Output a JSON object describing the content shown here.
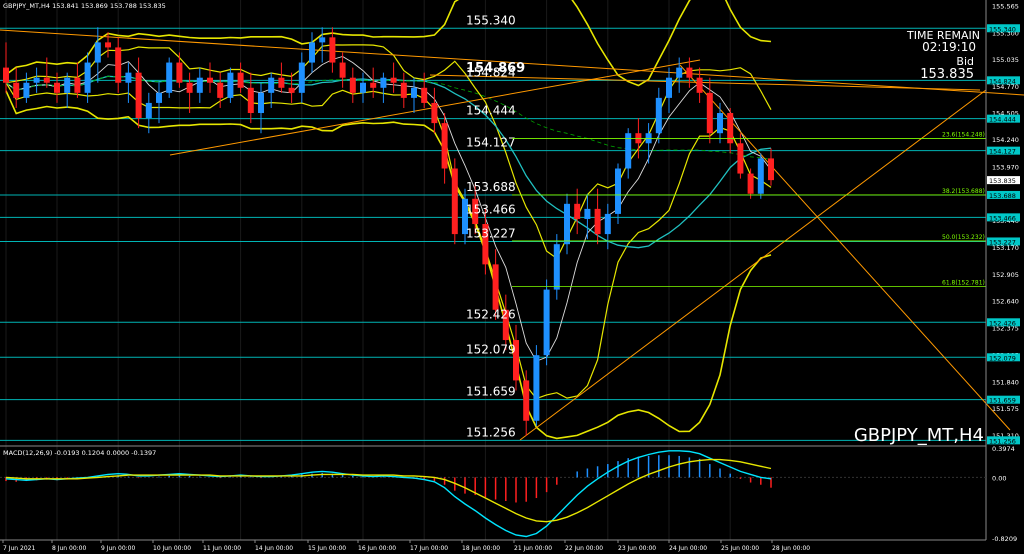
{
  "header": {
    "symbol_info": "GBPJPY_MT,H4  153.841  153.869  153.788  153.835",
    "macd_label": "MACD(12,26,9) -0.0193 0.1204 0.0000 -0.1397"
  },
  "overlay": {
    "time_remain_label": "TIME REMAIN",
    "time_remain_value": "02:19:10",
    "bid_label": "Bid",
    "bid_value": "153.835",
    "watermark": "GBPJPY_MT,H4"
  },
  "levels": [
    {
      "label": "155.340",
      "value": 155.34,
      "bold": false
    },
    {
      "label": "154.824",
      "value": 154.824,
      "bold": false
    },
    {
      "label": "154.869",
      "value": 154.869,
      "bold": true
    },
    {
      "label": "154.444",
      "value": 154.444,
      "bold": false
    },
    {
      "label": "154.127",
      "value": 154.127,
      "bold": false
    },
    {
      "label": "153.688",
      "value": 153.688,
      "bold": false
    },
    {
      "label": "153.466",
      "value": 153.466,
      "bold": false
    },
    {
      "label": "153.227",
      "value": 153.227,
      "bold": false
    },
    {
      "label": "152.426",
      "value": 152.426,
      "bold": false
    },
    {
      "label": "152.079",
      "value": 152.079,
      "bold": false
    },
    {
      "label": "151.659",
      "value": 151.659,
      "bold": false
    },
    {
      "label": "151.256",
      "value": 151.256,
      "bold": false
    }
  ],
  "fib_labels": [
    {
      "label": "23.6(154.248)",
      "value": 154.248
    },
    {
      "label": "38.2(153.688)",
      "value": 153.688
    },
    {
      "label": "50.0(153.232)",
      "value": 153.232
    },
    {
      "label": "61.8(152.781)",
      "value": 152.781
    }
  ],
  "price_axis": {
    "ticks": [
      "155.565",
      "155.300",
      "155.035",
      "154.770",
      "154.505",
      "154.240",
      "153.970",
      "153.705",
      "153.440",
      "153.170",
      "152.905",
      "152.640",
      "152.375",
      "152.105",
      "151.840",
      "151.575",
      "151.310"
    ],
    "ymin": 151.2,
    "ymax": 155.62,
    "badges": [
      {
        "label": "155.340",
        "value": 155.34,
        "color": "#00c8c8"
      },
      {
        "label": "154.824",
        "value": 154.824,
        "color": "#00c8c8"
      },
      {
        "label": "154.444",
        "value": 154.444,
        "color": "#00c8c8"
      },
      {
        "label": "154.127",
        "value": 154.127,
        "color": "#00c8c8"
      },
      {
        "label": "153.835",
        "value": 153.835,
        "color": "#ffffff"
      },
      {
        "label": "153.688",
        "value": 153.688,
        "color": "#00c8c8"
      },
      {
        "label": "153.466",
        "value": 153.466,
        "color": "#00c8c8"
      },
      {
        "label": "153.227",
        "value": 153.227,
        "color": "#00c8c8"
      },
      {
        "label": "152.426",
        "value": 152.426,
        "color": "#00c8c8"
      },
      {
        "label": "152.079",
        "value": 152.079,
        "color": "#00c8c8"
      },
      {
        "label": "151.659",
        "value": 151.659,
        "color": "#00c8c8"
      },
      {
        "label": "151.256",
        "value": 151.256,
        "color": "#00c8c8"
      }
    ]
  },
  "macd_axis": {
    "ticks": [
      "0.3974",
      "0.00",
      "-0.8209"
    ],
    "values": [
      0.3974,
      0.0,
      -0.8209
    ]
  },
  "time_axis": [
    "7 Jun 2021",
    "8 Jun 00:00",
    "9 Jun 00:00",
    "10 Jun 00:00",
    "11 Jun 00:00",
    "14 Jun 00:00",
    "15 Jun 00:00",
    "16 Jun 00:00",
    "17 Jun 00:00",
    "18 Jun 00:00",
    "21 Jun 00:00",
    "22 Jun 00:00",
    "23 Jun 00:00",
    "24 Jun 00:00",
    "25 Jun 00:00",
    "28 Jun 00:00"
  ],
  "colors": {
    "bull": "#1e90ff",
    "bear": "#ff2020",
    "level": "#00b4b4",
    "band": "#e6e600",
    "trend": "#ff9900",
    "fib": "#7fff00",
    "macd_hist_pos": "#1e90ff",
    "macd_hist_neg": "#ff2020",
    "macd_main": "#00e5ff",
    "macd_signal": "#e6e600"
  },
  "candles": [
    {
      "o": 154.95,
      "h": 155.2,
      "l": 154.7,
      "c": 154.8
    },
    {
      "o": 154.8,
      "h": 154.95,
      "l": 154.55,
      "c": 154.65
    },
    {
      "o": 154.65,
      "h": 154.9,
      "l": 154.6,
      "c": 154.8
    },
    {
      "o": 154.8,
      "h": 154.95,
      "l": 154.7,
      "c": 154.85
    },
    {
      "o": 154.85,
      "h": 155.05,
      "l": 154.75,
      "c": 154.8
    },
    {
      "o": 154.8,
      "h": 154.9,
      "l": 154.6,
      "c": 154.7
    },
    {
      "o": 154.7,
      "h": 154.9,
      "l": 154.55,
      "c": 154.85
    },
    {
      "o": 154.85,
      "h": 155.0,
      "l": 154.65,
      "c": 154.7
    },
    {
      "o": 154.7,
      "h": 155.1,
      "l": 154.6,
      "c": 155.0
    },
    {
      "o": 155.0,
      "h": 155.35,
      "l": 154.8,
      "c": 155.2
    },
    {
      "o": 155.2,
      "h": 155.3,
      "l": 155.05,
      "c": 155.15
    },
    {
      "o": 155.15,
      "h": 155.25,
      "l": 154.7,
      "c": 154.8
    },
    {
      "o": 154.8,
      "h": 155.0,
      "l": 154.6,
      "c": 154.9
    },
    {
      "o": 154.9,
      "h": 155.05,
      "l": 154.35,
      "c": 154.45
    },
    {
      "o": 154.45,
      "h": 154.7,
      "l": 154.3,
      "c": 154.6
    },
    {
      "o": 154.6,
      "h": 154.8,
      "l": 154.4,
      "c": 154.7
    },
    {
      "o": 154.7,
      "h": 155.05,
      "l": 154.65,
      "c": 155.0
    },
    {
      "o": 155.0,
      "h": 155.1,
      "l": 154.75,
      "c": 154.8
    },
    {
      "o": 154.8,
      "h": 154.9,
      "l": 154.5,
      "c": 154.7
    },
    {
      "o": 154.7,
      "h": 154.95,
      "l": 154.6,
      "c": 154.85
    },
    {
      "o": 154.85,
      "h": 155.0,
      "l": 154.7,
      "c": 154.8
    },
    {
      "o": 154.8,
      "h": 154.9,
      "l": 154.55,
      "c": 154.65
    },
    {
      "o": 154.65,
      "h": 154.95,
      "l": 154.6,
      "c": 154.9
    },
    {
      "o": 154.9,
      "h": 155.0,
      "l": 154.7,
      "c": 154.75
    },
    {
      "o": 154.75,
      "h": 154.9,
      "l": 154.4,
      "c": 154.5
    },
    {
      "o": 154.5,
      "h": 154.8,
      "l": 154.3,
      "c": 154.7
    },
    {
      "o": 154.7,
      "h": 154.9,
      "l": 154.55,
      "c": 154.85
    },
    {
      "o": 154.85,
      "h": 155.0,
      "l": 154.7,
      "c": 154.75
    },
    {
      "o": 154.75,
      "h": 154.9,
      "l": 154.6,
      "c": 154.7
    },
    {
      "o": 154.7,
      "h": 155.1,
      "l": 154.6,
      "c": 155.0
    },
    {
      "o": 155.0,
      "h": 155.3,
      "l": 154.9,
      "c": 155.2
    },
    {
      "o": 155.2,
      "h": 155.35,
      "l": 155.0,
      "c": 155.25
    },
    {
      "o": 155.25,
      "h": 155.35,
      "l": 154.9,
      "c": 155.0
    },
    {
      "o": 155.0,
      "h": 155.1,
      "l": 154.75,
      "c": 154.85
    },
    {
      "o": 154.85,
      "h": 154.95,
      "l": 154.6,
      "c": 154.7
    },
    {
      "o": 154.7,
      "h": 154.9,
      "l": 154.6,
      "c": 154.8
    },
    {
      "o": 154.8,
      "h": 154.95,
      "l": 154.65,
      "c": 154.75
    },
    {
      "o": 154.75,
      "h": 154.9,
      "l": 154.6,
      "c": 154.85
    },
    {
      "o": 154.85,
      "h": 155.0,
      "l": 154.7,
      "c": 154.8
    },
    {
      "o": 154.8,
      "h": 154.9,
      "l": 154.55,
      "c": 154.65
    },
    {
      "o": 154.65,
      "h": 154.85,
      "l": 154.5,
      "c": 154.75
    },
    {
      "o": 154.75,
      "h": 154.9,
      "l": 154.55,
      "c": 154.6
    },
    {
      "o": 154.6,
      "h": 154.75,
      "l": 154.3,
      "c": 154.4
    },
    {
      "o": 154.4,
      "h": 154.5,
      "l": 153.8,
      "c": 153.95
    },
    {
      "o": 153.95,
      "h": 154.05,
      "l": 153.2,
      "c": 153.3
    },
    {
      "o": 153.3,
      "h": 153.75,
      "l": 153.2,
      "c": 153.65
    },
    {
      "o": 153.65,
      "h": 153.8,
      "l": 153.3,
      "c": 153.4
    },
    {
      "o": 153.4,
      "h": 153.55,
      "l": 152.9,
      "c": 153.0
    },
    {
      "o": 153.0,
      "h": 153.15,
      "l": 152.45,
      "c": 152.55
    },
    {
      "o": 152.55,
      "h": 152.7,
      "l": 152.15,
      "c": 152.25
    },
    {
      "o": 152.25,
      "h": 152.4,
      "l": 151.75,
      "c": 151.85
    },
    {
      "o": 151.85,
      "h": 151.95,
      "l": 151.3,
      "c": 151.45
    },
    {
      "o": 151.45,
      "h": 152.2,
      "l": 151.4,
      "c": 152.1
    },
    {
      "o": 152.1,
      "h": 152.85,
      "l": 152.0,
      "c": 152.75
    },
    {
      "o": 152.75,
      "h": 153.3,
      "l": 152.65,
      "c": 153.2
    },
    {
      "o": 153.2,
      "h": 153.7,
      "l": 153.1,
      "c": 153.6
    },
    {
      "o": 153.6,
      "h": 153.75,
      "l": 153.3,
      "c": 153.45
    },
    {
      "o": 153.45,
      "h": 153.7,
      "l": 153.25,
      "c": 153.55
    },
    {
      "o": 153.55,
      "h": 153.75,
      "l": 153.2,
      "c": 153.3
    },
    {
      "o": 153.3,
      "h": 153.6,
      "l": 153.15,
      "c": 153.5
    },
    {
      "o": 153.5,
      "h": 154.0,
      "l": 153.4,
      "c": 153.95
    },
    {
      "o": 153.95,
      "h": 154.35,
      "l": 153.85,
      "c": 154.3
    },
    {
      "o": 154.3,
      "h": 154.45,
      "l": 154.05,
      "c": 154.2
    },
    {
      "o": 154.2,
      "h": 154.4,
      "l": 154.0,
      "c": 154.3
    },
    {
      "o": 154.3,
      "h": 154.75,
      "l": 154.2,
      "c": 154.65
    },
    {
      "o": 154.65,
      "h": 154.95,
      "l": 154.5,
      "c": 154.85
    },
    {
      "o": 154.85,
      "h": 155.05,
      "l": 154.7,
      "c": 154.95
    },
    {
      "o": 154.95,
      "h": 155.05,
      "l": 154.75,
      "c": 154.85
    },
    {
      "o": 154.85,
      "h": 154.95,
      "l": 154.6,
      "c": 154.7
    },
    {
      "o": 154.7,
      "h": 154.85,
      "l": 154.2,
      "c": 154.3
    },
    {
      "o": 154.3,
      "h": 154.6,
      "l": 154.2,
      "c": 154.5
    },
    {
      "o": 154.5,
      "h": 154.55,
      "l": 154.1,
      "c": 154.2
    },
    {
      "o": 154.2,
      "h": 154.3,
      "l": 153.85,
      "c": 153.9
    },
    {
      "o": 153.9,
      "h": 153.95,
      "l": 153.65,
      "c": 153.7
    },
    {
      "o": 153.7,
      "h": 154.1,
      "l": 153.65,
      "c": 154.05
    },
    {
      "o": 154.05,
      "h": 154.15,
      "l": 153.78,
      "c": 153.835
    }
  ],
  "macd_hist": [
    -0.05,
    -0.06,
    -0.05,
    -0.04,
    -0.03,
    -0.04,
    -0.03,
    -0.02,
    -0.01,
    0.01,
    0.02,
    0.03,
    0.01,
    -0.01,
    0.0,
    0.01,
    0.02,
    0.03,
    0.02,
    0.01,
    0.0,
    -0.01,
    0.01,
    0.02,
    0.01,
    -0.01,
    0.0,
    0.01,
    0.02,
    0.04,
    0.05,
    0.06,
    0.05,
    0.04,
    0.02,
    0.01,
    0.0,
    0.01,
    0.0,
    -0.01,
    -0.02,
    -0.03,
    -0.05,
    -0.1,
    -0.18,
    -0.22,
    -0.24,
    -0.27,
    -0.3,
    -0.32,
    -0.34,
    -0.33,
    -0.28,
    -0.2,
    -0.1,
    0.0,
    0.08,
    0.12,
    0.15,
    0.18,
    0.22,
    0.26,
    0.28,
    0.29,
    0.3,
    0.3,
    0.29,
    0.27,
    0.25,
    0.18,
    0.12,
    0.05,
    -0.02,
    -0.07,
    -0.1,
    -0.14
  ],
  "macd_main": [
    -0.02,
    -0.03,
    -0.04,
    -0.03,
    -0.02,
    -0.03,
    -0.02,
    -0.01,
    0.0,
    0.02,
    0.04,
    0.05,
    0.04,
    0.02,
    0.02,
    0.03,
    0.04,
    0.05,
    0.04,
    0.03,
    0.02,
    0.01,
    0.02,
    0.03,
    0.02,
    0.01,
    0.01,
    0.02,
    0.03,
    0.05,
    0.07,
    0.08,
    0.07,
    0.05,
    0.03,
    0.02,
    0.01,
    0.02,
    0.01,
    0.0,
    -0.01,
    -0.03,
    -0.06,
    -0.14,
    -0.26,
    -0.36,
    -0.45,
    -0.55,
    -0.64,
    -0.72,
    -0.78,
    -0.8,
    -0.76,
    -0.66,
    -0.52,
    -0.38,
    -0.24,
    -0.12,
    -0.02,
    0.07,
    0.15,
    0.22,
    0.27,
    0.31,
    0.34,
    0.36,
    0.36,
    0.35,
    0.32,
    0.26,
    0.2,
    0.14,
    0.08,
    0.04,
    0.0,
    -0.02
  ],
  "macd_signal": [
    0.0,
    -0.01,
    -0.02,
    -0.02,
    -0.02,
    -0.02,
    -0.02,
    -0.02,
    -0.01,
    0.0,
    0.01,
    0.02,
    0.03,
    0.03,
    0.03,
    0.03,
    0.03,
    0.03,
    0.03,
    0.03,
    0.03,
    0.02,
    0.02,
    0.02,
    0.02,
    0.02,
    0.02,
    0.02,
    0.02,
    0.02,
    0.03,
    0.04,
    0.04,
    0.04,
    0.04,
    0.03,
    0.03,
    0.03,
    0.03,
    0.02,
    0.02,
    0.01,
    0.0,
    -0.03,
    -0.08,
    -0.14,
    -0.21,
    -0.28,
    -0.35,
    -0.42,
    -0.49,
    -0.55,
    -0.59,
    -0.6,
    -0.58,
    -0.54,
    -0.48,
    -0.41,
    -0.33,
    -0.25,
    -0.17,
    -0.09,
    -0.02,
    0.04,
    0.09,
    0.14,
    0.18,
    0.21,
    0.23,
    0.24,
    0.24,
    0.23,
    0.21,
    0.18,
    0.15,
    0.12
  ]
}
